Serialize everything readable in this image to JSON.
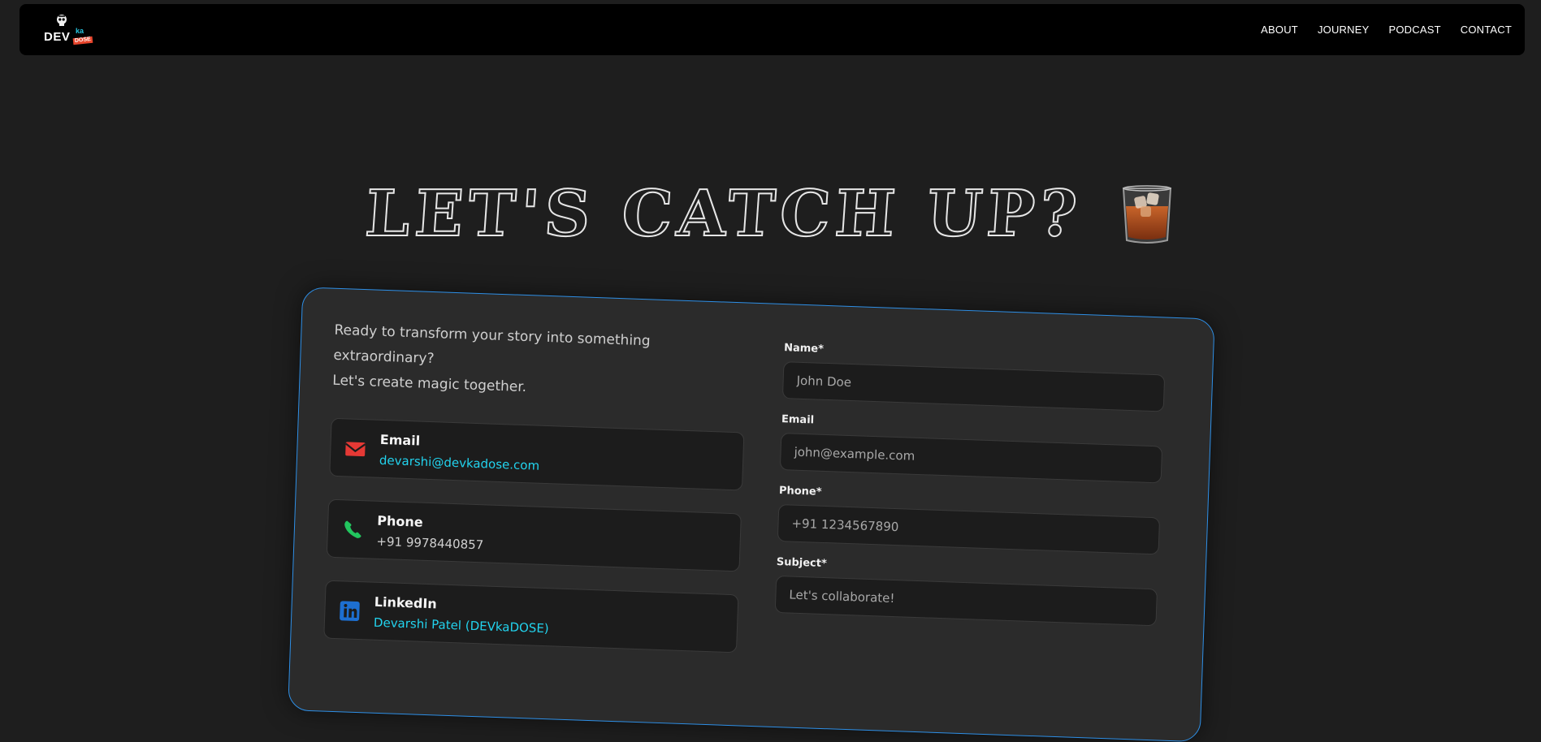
{
  "nav": {
    "logo": {
      "main": "DEV",
      "ka": "ka",
      "dose": "DOSE"
    },
    "links": [
      "ABOUT",
      "JOURNEY",
      "PODCAST",
      "CONTACT"
    ]
  },
  "hero": {
    "title": "LET'S CATCH UP?",
    "emoji_icon": "whiskey-glass-icon"
  },
  "contact": {
    "tagline_line1": "Ready to transform your story into something extraordinary?",
    "tagline_line2": "Let's create magic together.",
    "methods": [
      {
        "title": "Email",
        "value": "devarshi@devkadose.com",
        "icon": "envelope-icon",
        "color": "#e53935"
      },
      {
        "title": "Phone",
        "value": "+91 9978440857",
        "icon": "phone-icon",
        "color": "#22c55e"
      },
      {
        "title": "LinkedIn",
        "value": "Devarshi Patel (DEVkaDOSE)",
        "icon": "linkedin-icon",
        "color": "#1d6fd1"
      }
    ]
  },
  "form": {
    "name": {
      "label": "Name*",
      "placeholder": "John Doe"
    },
    "email": {
      "label": "Email",
      "placeholder": "john@example.com"
    },
    "phone": {
      "label": "Phone*",
      "placeholder": "+91 1234567890"
    },
    "subject": {
      "label": "Subject*",
      "placeholder": "Let's collaborate!"
    }
  },
  "colors": {
    "background": "#1e1e1e",
    "card": "#2b2b2b",
    "card_border": "#2e8fe6",
    "link": "#22d3ee"
  }
}
